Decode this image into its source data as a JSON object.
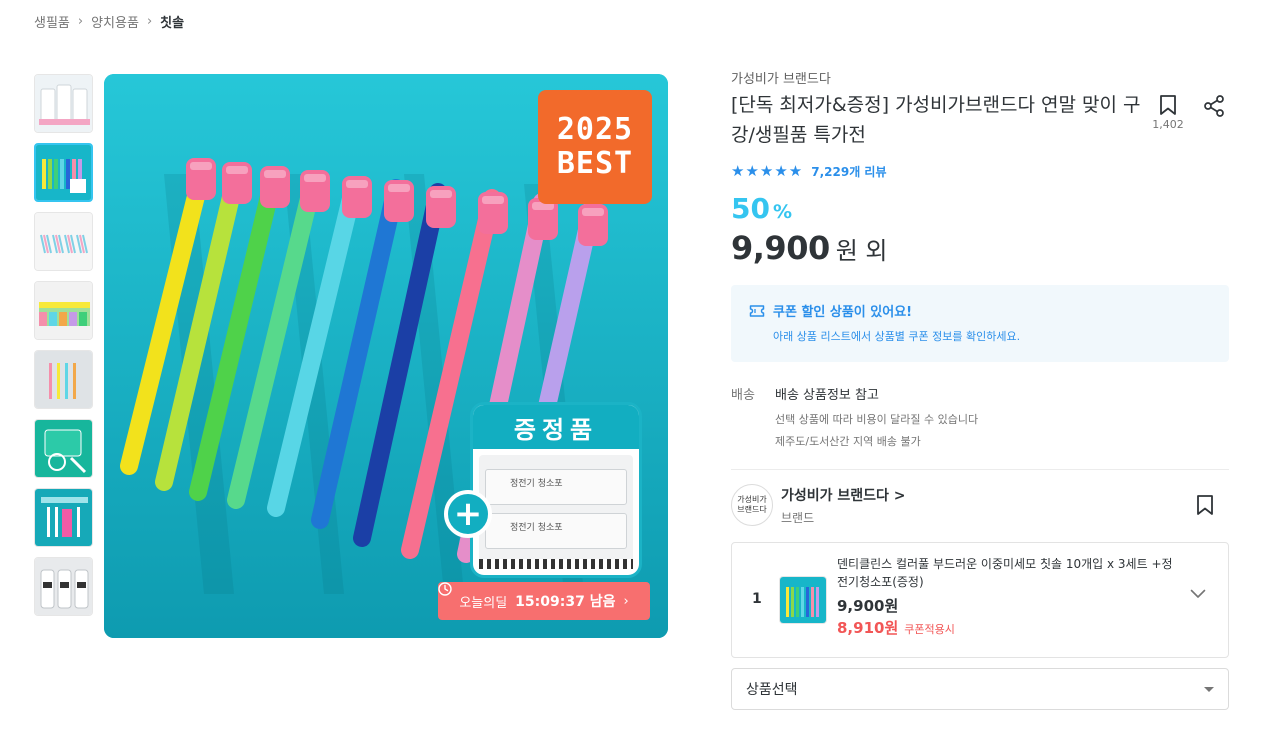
{
  "breadcrumb": {
    "items": [
      "생필품",
      "양치용품",
      "칫솔"
    ]
  },
  "thumbnails": [
    "toothbrush-set",
    "colorful-toothbrushes",
    "toothbrush-heads",
    "toothbrush-row",
    "toothbrush-display",
    "floss-pack",
    "gift-pack",
    "product-bottles"
  ],
  "main_image": {
    "badge_line1": "2025",
    "badge_line2": "BEST",
    "gift_title": "증정품",
    "gift_pack1": "정전기 청소포",
    "gift_pack2": "정전기 청소포",
    "timer_label": "오늘의딜",
    "timer_time": "15:09:37 남음",
    "timer_arrow": "›"
  },
  "product": {
    "brand": "가성비가 브랜드다",
    "title": "[단독 최저가&증정] 가성비가브랜드다 연말 맞이 구강/생필품 특가전",
    "scrap_count": "1,402",
    "stars": "★★★★★",
    "review_count": "7,229개 리뷰",
    "discount": "50",
    "discount_unit": "%",
    "price": "9,900",
    "price_unit": "원 외"
  },
  "coupon": {
    "title": "쿠폰 할인 상품이 있어요!",
    "desc": "아래 상품 리스트에서 상품별 쿠폰 정보를 확인하세요."
  },
  "shipping": {
    "label": "배송",
    "main": "배송 상품정보 참고",
    "sub1": "선택 상품에 따라 비용이 달라질 수 있습니다",
    "sub2": "제주도/도서산간 지역 배송 불가"
  },
  "seller": {
    "logo_line1": "가성비가",
    "logo_line2": "브랜드다",
    "name": "가성비가 브랜드다 >",
    "sub": "브랜드"
  },
  "option": {
    "number": "1",
    "name": "덴티클린스 컬러풀 부드러운 이중미세모 칫솔 10개입 x 3세트 +정전기청소포(증정)",
    "price": "9,900원",
    "coupon_price": "8,910원",
    "coupon_note": "쿠폰적용시"
  },
  "select": {
    "placeholder": "상품선택"
  },
  "colors": {
    "accent": "#35c5f0",
    "star": "#2b8fea",
    "sale": "#f25656",
    "timer": "#f76f6f",
    "badge": "#f26a2b"
  }
}
